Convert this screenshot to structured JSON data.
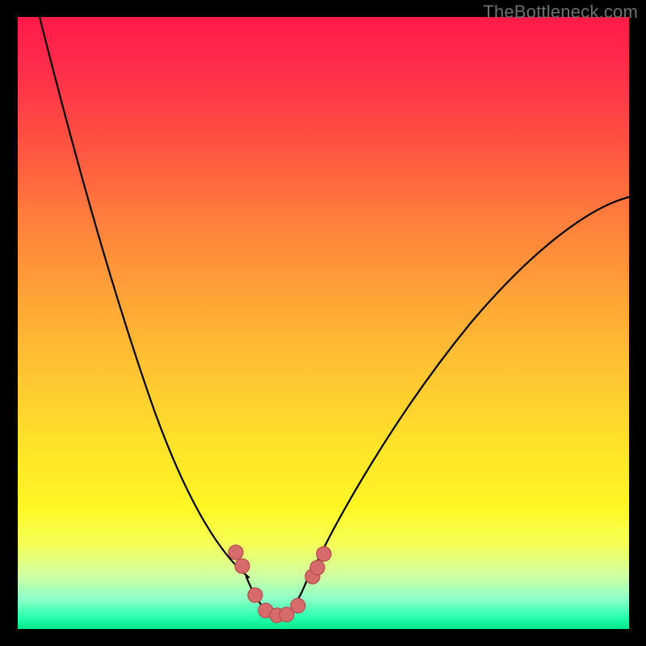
{
  "watermark": "TheBottleneck.com",
  "colors": {
    "frame": "#000000",
    "watermark": "#6f6f70",
    "gradient_top": "#ff1a4a",
    "gradient_bottom": "#00e88a",
    "curve_stroke": "#000000",
    "marker_fill": "#d76a6a",
    "marker_stroke": "#b64f4f"
  },
  "chart_data": {
    "type": "line",
    "title": "",
    "xlabel": "",
    "ylabel": "",
    "xlim": [
      0,
      100
    ],
    "ylim": [
      0,
      100
    ],
    "grid": false,
    "legend": false,
    "note": "V-shaped bottleneck curve on red-to-green gradient; axes/ticks are not drawn in the image, so x/y are normalized 0-100 estimates from pixel positions.",
    "series": [
      {
        "name": "left-branch",
        "x": [
          3.6,
          5.4,
          7.3,
          9.2,
          11.1,
          13.0,
          14.8,
          16.7,
          18.6,
          20.6,
          22.5,
          24.4,
          26.4,
          28.2,
          30.2,
          32.1,
          34.0,
          35.8,
          37.8
        ],
        "y": [
          100.0,
          91.3,
          83.4,
          76.2,
          69.6,
          63.5,
          57.8,
          52.5,
          47.6,
          42.9,
          38.5,
          34.3,
          30.3,
          26.5,
          22.8,
          19.2,
          15.6,
          12.1,
          8.5
        ]
      },
      {
        "name": "right-branch",
        "x": [
          47.7,
          49.4,
          51.2,
          53.1,
          55.7,
          58.3,
          60.9,
          63.6,
          66.2,
          69.5,
          72.7,
          76.0,
          79.2,
          82.5,
          85.8,
          89.0,
          92.3,
          95.6,
          98.8
        ],
        "y": [
          8.3,
          11.6,
          14.9,
          18.2,
          22.3,
          26.2,
          29.9,
          33.5,
          37.0,
          41.1,
          44.9,
          48.6,
          52.2,
          55.5,
          58.8,
          61.9,
          64.9,
          67.8,
          70.6
        ]
      },
      {
        "name": "trough",
        "x": [
          37.4,
          38.4,
          39.2,
          39.9,
          40.6,
          41.4,
          42.2,
          43.0,
          43.7,
          44.5,
          45.2,
          46.0,
          46.8,
          47.4
        ],
        "y": [
          8.5,
          6.0,
          4.3,
          3.1,
          2.3,
          1.8,
          1.6,
          1.6,
          1.9,
          2.4,
          3.2,
          4.4,
          6.0,
          8.1
        ]
      }
    ],
    "markers": {
      "name": "highlight-points",
      "points": [
        {
          "x": 35.7,
          "y": 12.5
        },
        {
          "x": 36.7,
          "y": 10.3
        },
        {
          "x": 38.8,
          "y": 5.5
        },
        {
          "x": 40.6,
          "y": 3.0
        },
        {
          "x": 42.4,
          "y": 2.2
        },
        {
          "x": 44.0,
          "y": 2.4
        },
        {
          "x": 45.8,
          "y": 3.8
        },
        {
          "x": 48.2,
          "y": 8.6
        },
        {
          "x": 49.0,
          "y": 10.0
        },
        {
          "x": 50.1,
          "y": 12.3
        }
      ],
      "radius_px": 9
    }
  }
}
